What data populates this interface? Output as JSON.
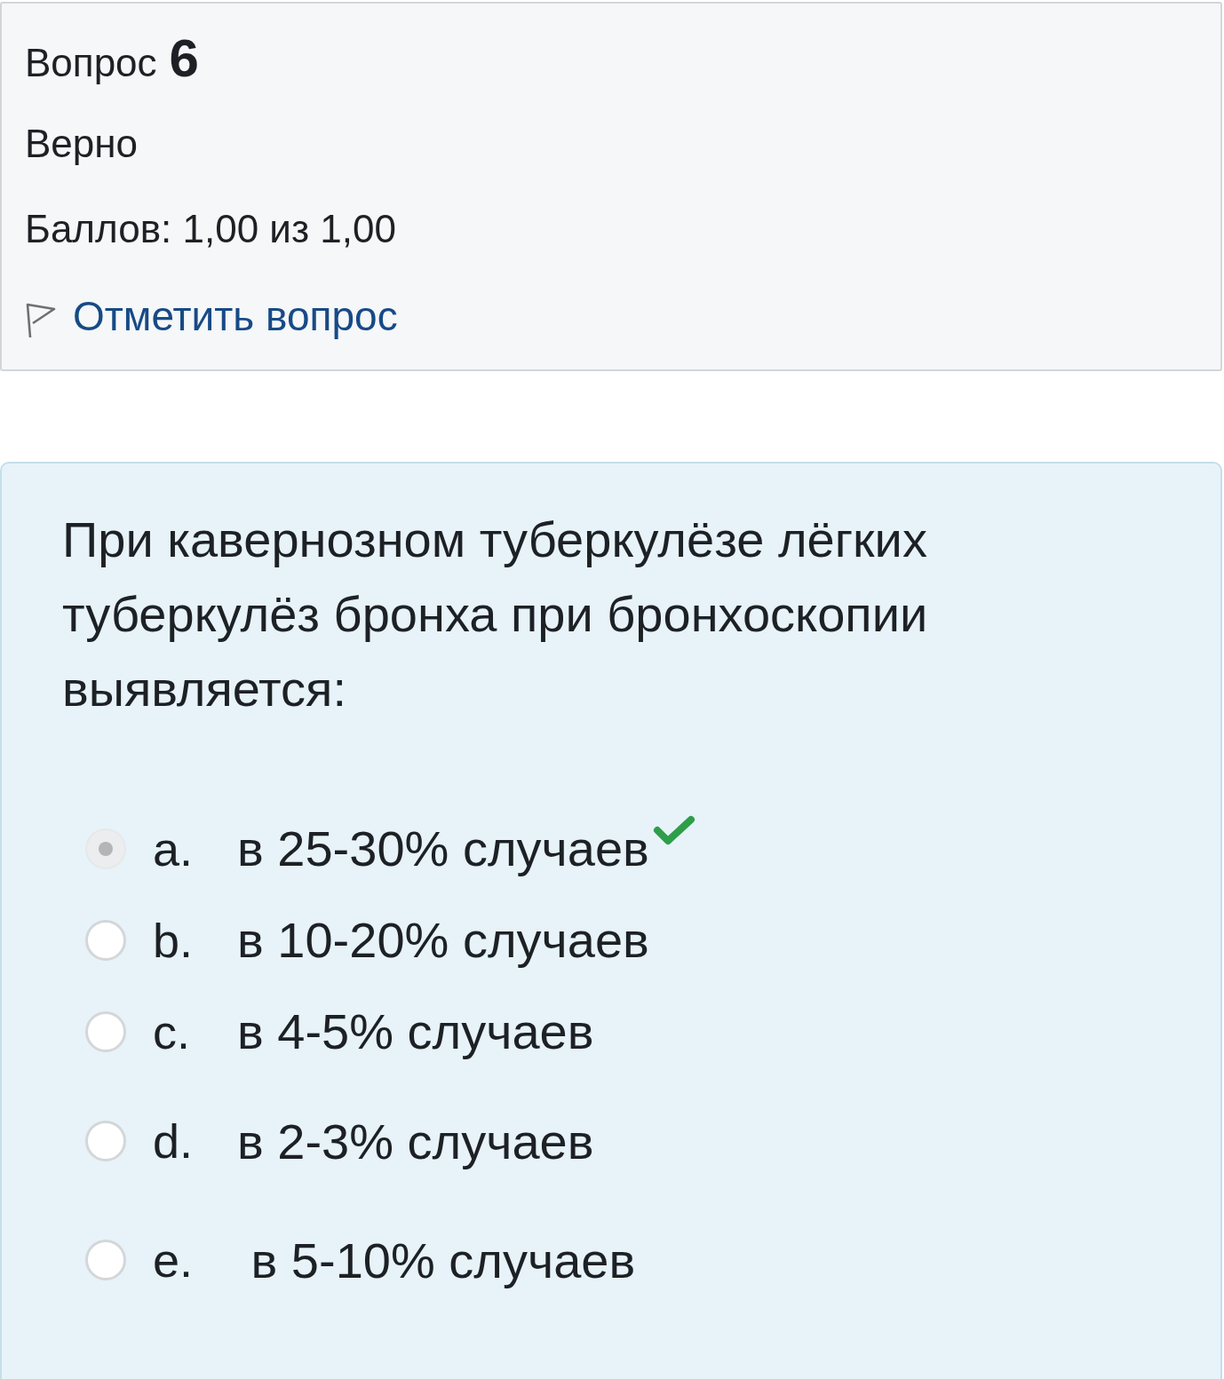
{
  "question_info": {
    "label": "Вопрос",
    "number": "6",
    "status": "Верно",
    "grade": "Баллов: 1,00 из 1,00",
    "flag_link": "Отметить вопрос",
    "flagged": false
  },
  "question": {
    "text": "При кавернозном туберкулёзе лёгких туберкулёз бронха при бронхоскопии выявляется:",
    "answers": [
      {
        "letter": "a.",
        "text": "в 25-30% случаев",
        "selected": true,
        "correct": true
      },
      {
        "letter": "b.",
        "text": "в 10-20% случаев",
        "selected": false,
        "correct": false
      },
      {
        "letter": "c.",
        "text": "в 4-5% случаев",
        "selected": false,
        "correct": false
      },
      {
        "letter": "d.",
        "text": "в 2-3% случаев",
        "selected": false,
        "correct": false
      },
      {
        "letter": "e.",
        "text": " в 5-10% случаев",
        "selected": false,
        "correct": false
      }
    ]
  }
}
